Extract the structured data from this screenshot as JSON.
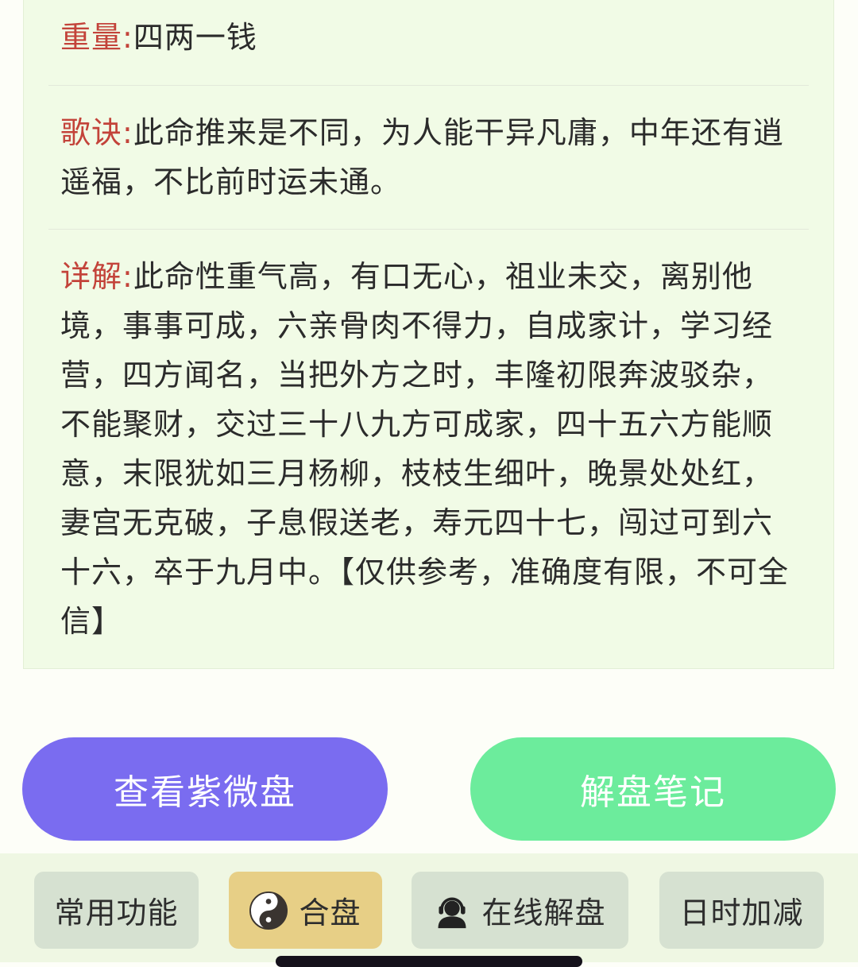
{
  "detail": {
    "weight_label": "重量:",
    "weight_value": "四两一钱",
    "verse_label": "歌诀:",
    "verse_value": "此命推来是不同，为人能干异凡庸，中年还有逍遥福，不比前时运未通。",
    "explain_label": "详解:",
    "explain_value": "此命性重气高，有口无心，祖业未交，离别他境，事事可成，六亲骨肉不得力，自成家计，学习经营，四方闻名，当把外方之时，丰隆初限奔波驳杂，不能聚财，交过三十八九方可成家，四十五六方能顺意，末限犹如三月杨柳，枝枝生细叶，晚景处处红，妻宫无克破，子息假送老，寿元四十七，闯过可到六十六，卒于九月中。【仅供参考，准确度有限，不可全信】"
  },
  "actions": {
    "view_chart_label": "查看紫微盘",
    "notes_label": "解盘笔记"
  },
  "tabs": [
    {
      "label": "常用功能",
      "icon": "none"
    },
    {
      "label": "合盘",
      "icon": "yin-yang-icon"
    },
    {
      "label": "在线解盘",
      "icon": "headset-user-icon"
    },
    {
      "label": "日时加减",
      "icon": "none"
    }
  ],
  "colors": {
    "label_red": "#c3433a",
    "button_purple": "#7a6cf0",
    "button_green": "#6cec9c",
    "tab_active": "#e7cf86"
  }
}
